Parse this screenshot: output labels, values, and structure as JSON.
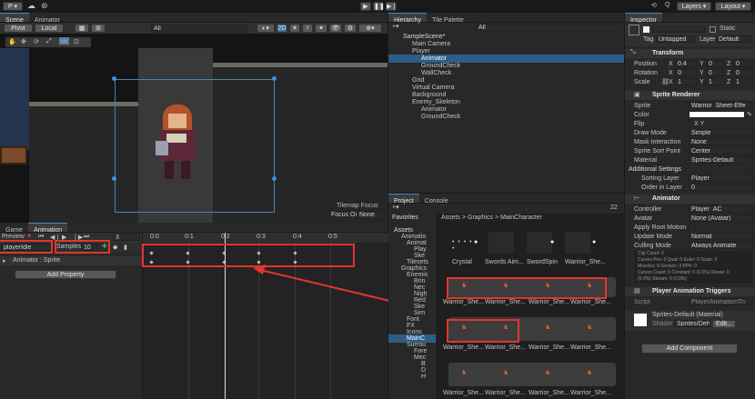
{
  "toolbar": {
    "account": "P ▾",
    "cloud": "☁",
    "collab": "⊛",
    "search": "Q",
    "layers": "Layers",
    "layout": "Layout"
  },
  "scene": {
    "tabs": [
      "Scene",
      "Animator"
    ],
    "pivot": "Pivot",
    "local": "Local",
    "search_placeholder": "All",
    "mode2d": "2D",
    "tilemap_focus": "Tilemap Focus",
    "focus_on": "Focus On",
    "focus_value": "None"
  },
  "hierarchy": {
    "tabs": [
      "Hierarchy",
      "Tile Palette"
    ],
    "search_placeholder": "All",
    "items": [
      "SampleScene*",
      "Main Camera",
      "Player",
      "Animator",
      "GroundCheck",
      "WallCheck",
      "Grid",
      "Virtual Camera",
      "Background",
      "Enemy_Skeleton",
      "Animator",
      "GroundCheck"
    ]
  },
  "animation": {
    "tabs": [
      "Game",
      "Animation"
    ],
    "preview": "Preview",
    "frame": "3",
    "clip": "playerIdle",
    "samples_label": "Samples",
    "samples_value": "10",
    "property": "Animator : Sprite",
    "add_property": "Add Property",
    "ruler": [
      "0:0",
      "0:1",
      "0:2",
      "0:3",
      "0:4",
      "0:5"
    ]
  },
  "project": {
    "tabs": [
      "Project",
      "Console"
    ],
    "count": "22",
    "breadcrumb": [
      "Assets",
      "Graphics",
      "MainCharacter"
    ],
    "favorites": "Favorites",
    "tree": [
      "Assets",
      "Animatio",
      "Animat",
      "Play",
      "Ske",
      "Tilesets",
      "Graphics",
      "Enemis",
      "Brin",
      "Nec",
      "Nigh",
      "Red",
      "Ske",
      "Sim",
      "Font",
      "FX",
      "Icons",
      "MainC",
      "Surrou",
      "Fore",
      "Mec",
      "B",
      "D",
      "H"
    ],
    "row1_labels": [
      "Crystal",
      "Swords Aim...",
      "SwordSpin",
      "Warrior_She..."
    ],
    "warrior_label": "Warrior_She..."
  },
  "inspector": {
    "tab": "Inspector",
    "static": "Static",
    "tag_label": "Tag",
    "tag_value": "Untagged",
    "layer_label": "Layer",
    "layer_value": "Default",
    "transform": {
      "title": "Transform",
      "position": {
        "label": "Position",
        "x": "0.4",
        "y": "0",
        "z": "0"
      },
      "rotation": {
        "label": "Rotation",
        "x": "0",
        "y": "0",
        "z": "0"
      },
      "scale": {
        "label": "Scale",
        "x": "1",
        "y": "1",
        "z": "1"
      }
    },
    "sprite_renderer": {
      "title": "Sprite Renderer",
      "rows": [
        {
          "label": "Sprite",
          "value": "Warrior_Sheet-Effe"
        },
        {
          "label": "Color",
          "value": ""
        },
        {
          "label": "Flip",
          "value": "X   Y"
        },
        {
          "label": "Draw Mode",
          "value": "Simple"
        },
        {
          "label": "Mask Interaction",
          "value": "None"
        },
        {
          "label": "Sprite Sort Point",
          "value": "Center"
        },
        {
          "label": "Material",
          "value": "Sprites-Default"
        }
      ],
      "additional": "Additional Settings",
      "sorting_layer_label": "Sorting Layer",
      "sorting_layer_value": "Player",
      "order_label": "Order in Layer",
      "order_value": "0"
    },
    "animator": {
      "title": "Animator",
      "rows": [
        {
          "label": "Controller",
          "value": "Player_AC"
        },
        {
          "label": "Avatar",
          "value": "None (Avatar)"
        },
        {
          "label": "Apply Root Motion",
          "value": ""
        },
        {
          "label": "Update Mode",
          "value": "Normal"
        },
        {
          "label": "Culling Mode",
          "value": "Always Animate"
        }
      ],
      "info": [
        "Clip Count: 0",
        "Curves Pos: 0 Quat: 0 Euler: 0 Scale: 0",
        "Muscles: 0 Generic: 0 PPtr: 0",
        "Curves Count: 0 Constant: 0 (0.0%) Dense: 0",
        "(0.0%) Stream: 0 (0.0%)"
      ]
    },
    "triggers": {
      "title": "Player Animation Triggers",
      "script_label": "Script",
      "script_value": "PlayerAnimationTri"
    },
    "material": {
      "title": "Sprites-Default (Material)",
      "shader_label": "Shader",
      "shader_value": "Sprites/Def▾",
      "edit": "Edit..."
    },
    "add_component": "Add Component"
  },
  "colors": {
    "highlight": "#e3342f",
    "selection": "#2c5d87",
    "accent": "#4a86c8"
  }
}
